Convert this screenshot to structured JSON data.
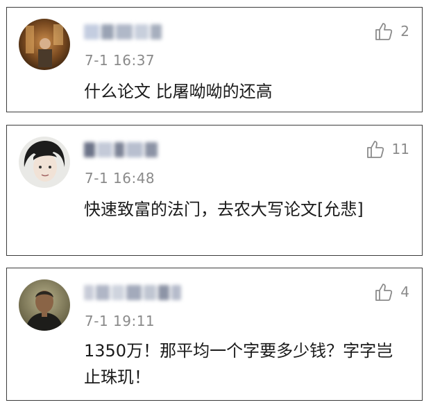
{
  "comments": [
    {
      "time": "7-1 16:37",
      "content": "什么论文 比屠呦呦的还高",
      "likes": "2",
      "avatar_icon": "user-avatar-photo"
    },
    {
      "time": "7-1 16:48",
      "content": "快速致富的法门，去农大写论文[允悲]",
      "likes": "11",
      "avatar_icon": "user-avatar-photo"
    },
    {
      "time": "7-1 19:11",
      "content": "1350万！那平均一个字要多少钱？字字岂止珠玑！",
      "likes": "4",
      "avatar_icon": "user-avatar-photo"
    }
  ],
  "colors": {
    "text": "#1a1a1a",
    "meta": "#8a8a8a",
    "border": "#3a3a3a"
  }
}
